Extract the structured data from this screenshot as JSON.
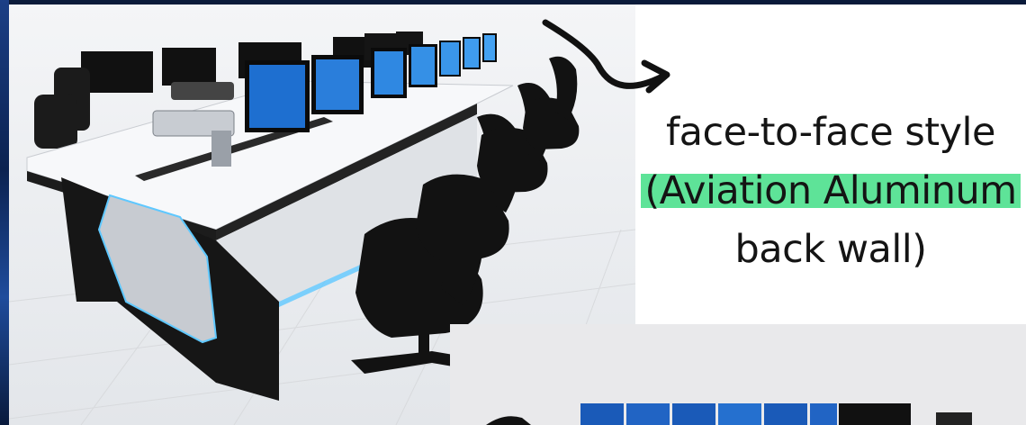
{
  "caption": {
    "line1": "face-to-face style",
    "line2": "(Aviation Aluminum",
    "line3": "back wall)"
  },
  "colors": {
    "highlight": "#5ee398",
    "frame": "#0a1a3a",
    "accent_light": "#5fc8ff"
  },
  "icons": {
    "arrow": "curved-arrow-icon"
  }
}
